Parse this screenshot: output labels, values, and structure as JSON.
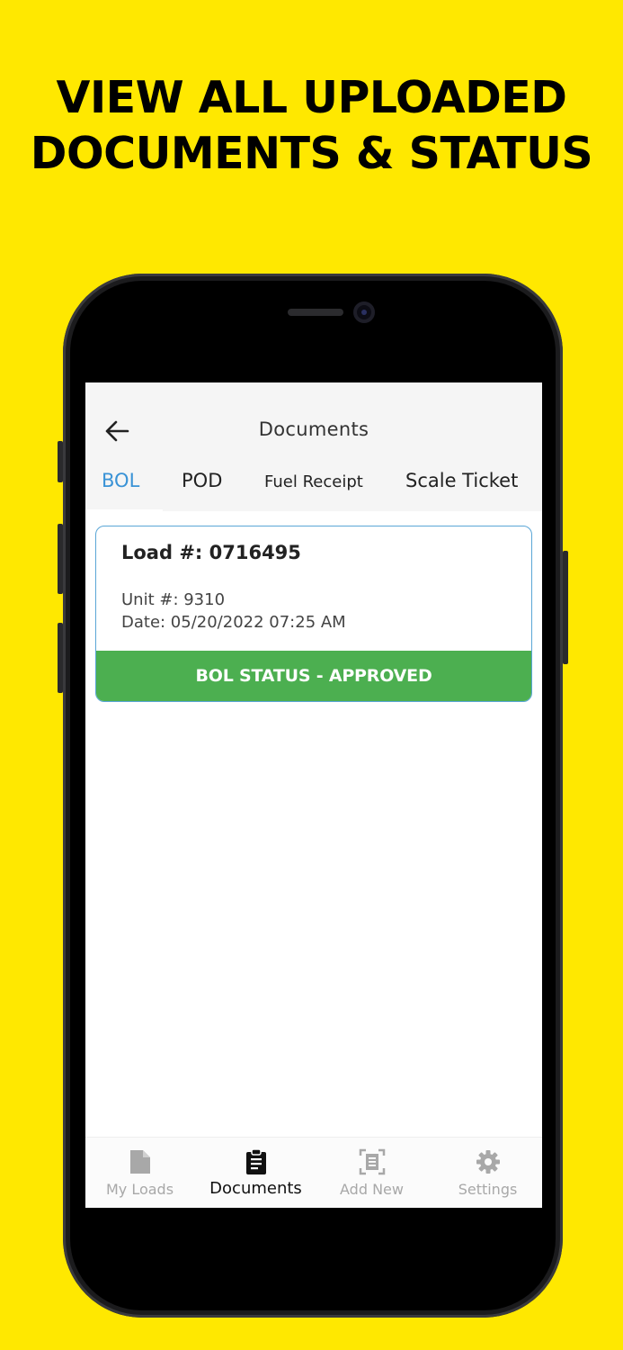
{
  "headline": {
    "line1": "VIEW ALL UPLOADED",
    "line2": "DOCUMENTS & STATUS"
  },
  "header": {
    "title": "Documents",
    "back_icon": "arrow-left-icon"
  },
  "tabs": [
    {
      "label": "BOL",
      "active": true
    },
    {
      "label": "POD",
      "active": false
    },
    {
      "label": "Fuel Receipt",
      "active": false
    },
    {
      "label": "Scale Ticket",
      "active": false
    }
  ],
  "document_card": {
    "load": "Load #: 0716495",
    "unit": "Unit #: 9310",
    "date": "Date: 05/20/2022 07:25 AM",
    "status": "BOL STATUS - APPROVED",
    "status_color": "#4caf50",
    "border_color": "#5aa6d6"
  },
  "bottom_nav": [
    {
      "label": "My Loads",
      "icon": "document-icon",
      "active": false
    },
    {
      "label": "Documents",
      "icon": "clipboard-icon",
      "active": true
    },
    {
      "label": "Add New",
      "icon": "scan-document-icon",
      "active": false
    },
    {
      "label": "Settings",
      "icon": "gear-icon",
      "active": false
    }
  ],
  "colors": {
    "background": "#FFE800",
    "tab_active": "#3a93d6"
  }
}
